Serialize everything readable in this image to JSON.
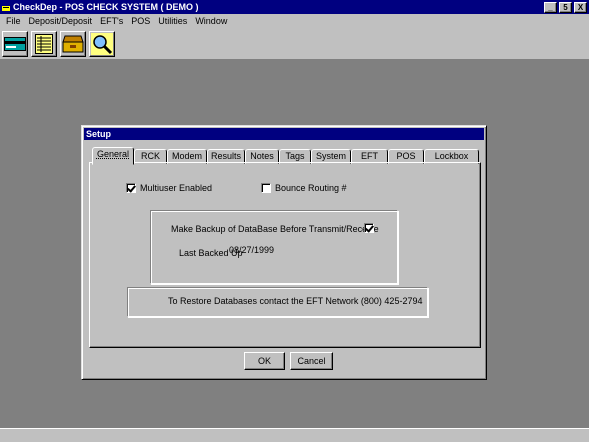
{
  "window": {
    "title": "CheckDep - POS CHECK SYSTEM ( DEMO )",
    "minimize_label": "_",
    "restore_label": "5",
    "close_label": "X"
  },
  "menu": {
    "items": [
      "File",
      "Deposit/Deposit",
      "EFT's",
      "POS",
      "Utilities",
      "Window"
    ]
  },
  "toolbar": {
    "buttons": [
      "card-icon",
      "ledger-icon",
      "cash-drawer-icon",
      "search-icon"
    ]
  },
  "dialog": {
    "title": "Setup",
    "tabs": [
      "General",
      "RCK",
      "Modem",
      "Results",
      "Notes",
      "Tags",
      "System",
      "EFT",
      "POS",
      "Lockbox"
    ],
    "active_tab": "General",
    "multiuser_label": "Multiuser Enabled",
    "multiuser_checked": true,
    "bounce_label": "Bounce Routing #",
    "bounce_checked": false,
    "backup_label": "Make Backup of DataBase Before Transmit/Receive",
    "backup_checked": true,
    "last_backed_up_label": "Last Backed Up",
    "last_backed_up_value": "08/27/1999",
    "restore_note": "To Restore Databases contact the EFT Network (800) 425-2794",
    "ok_label": "OK",
    "cancel_label": "Cancel"
  }
}
